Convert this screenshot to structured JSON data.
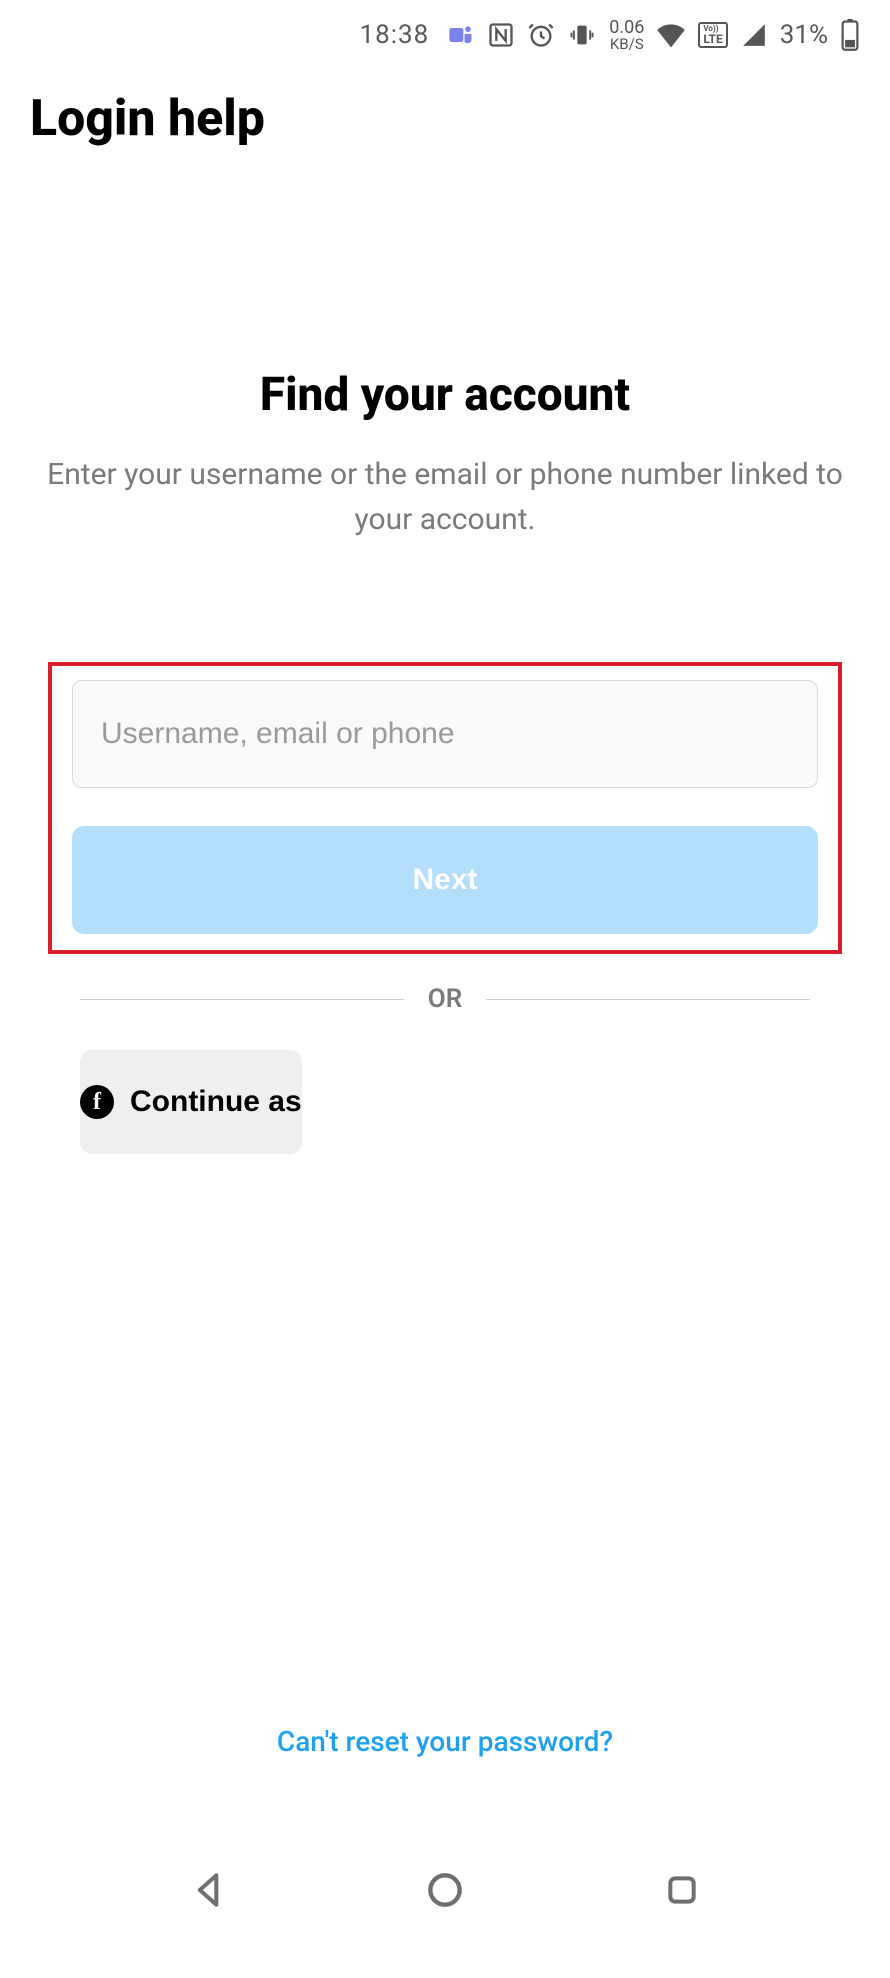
{
  "statusbar": {
    "time": "18:38",
    "net_speed_value": "0.06",
    "net_speed_unit": "KB/S",
    "volte_top": "Vo))",
    "volte_bottom": "LTE",
    "battery_percent": "31%"
  },
  "header": {
    "title": "Login help"
  },
  "intro": {
    "title": "Find your account",
    "text": "Enter your username or the email or phone number linked to your account."
  },
  "form": {
    "placeholder": "Username, email or phone",
    "value": "",
    "next_label": "Next"
  },
  "divider": {
    "label": "OR"
  },
  "facebook": {
    "label": "Continue as"
  },
  "footer": {
    "link": "Can't reset your password?"
  }
}
